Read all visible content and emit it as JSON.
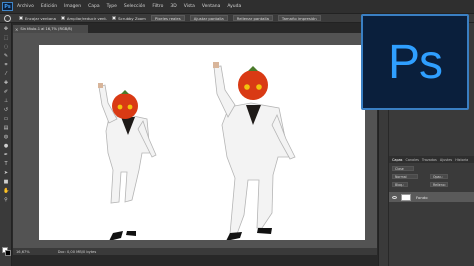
{
  "app": {
    "logo_mini": "Ps",
    "logo_big": "Ps",
    "accent_color": "#2f9fff"
  },
  "menu": [
    "Archivo",
    "Edición",
    "Imagen",
    "Capa",
    "Type",
    "Selección",
    "Filtro",
    "3D",
    "Vista",
    "Ventana",
    "Ayuda"
  ],
  "options": {
    "resize_windows": "Encajar ventana",
    "zoom_all_windows": "Ampliar/reducir vent.",
    "scrubby_zoom": "Scrubby Zoom",
    "actual_pixels": "Píxeles reales",
    "fit_screen": "Ajustar pantalla",
    "fill_screen": "Rellenar pantalla",
    "print_size": "Tamaño impresión"
  },
  "document": {
    "tab_title": "Sin título-1 al 16,7% (RGB/8)"
  },
  "status": {
    "zoom": "16,67%",
    "doc_size": "Doc: 0,00 MB/0 bytes"
  },
  "layers_panel": {
    "tabs": [
      "Capas",
      "Canales",
      "Trazados",
      "Ajustes",
      "Historia"
    ],
    "kind_filter": "Clase",
    "blend_mode": "Normal",
    "opacity_label": "Opac.:",
    "lock_label": "Bloq.:",
    "fill_label": "Relleno:",
    "layer_name": "Fondo"
  },
  "colors": {
    "foreground": "#ffffff",
    "background": "#000000"
  }
}
